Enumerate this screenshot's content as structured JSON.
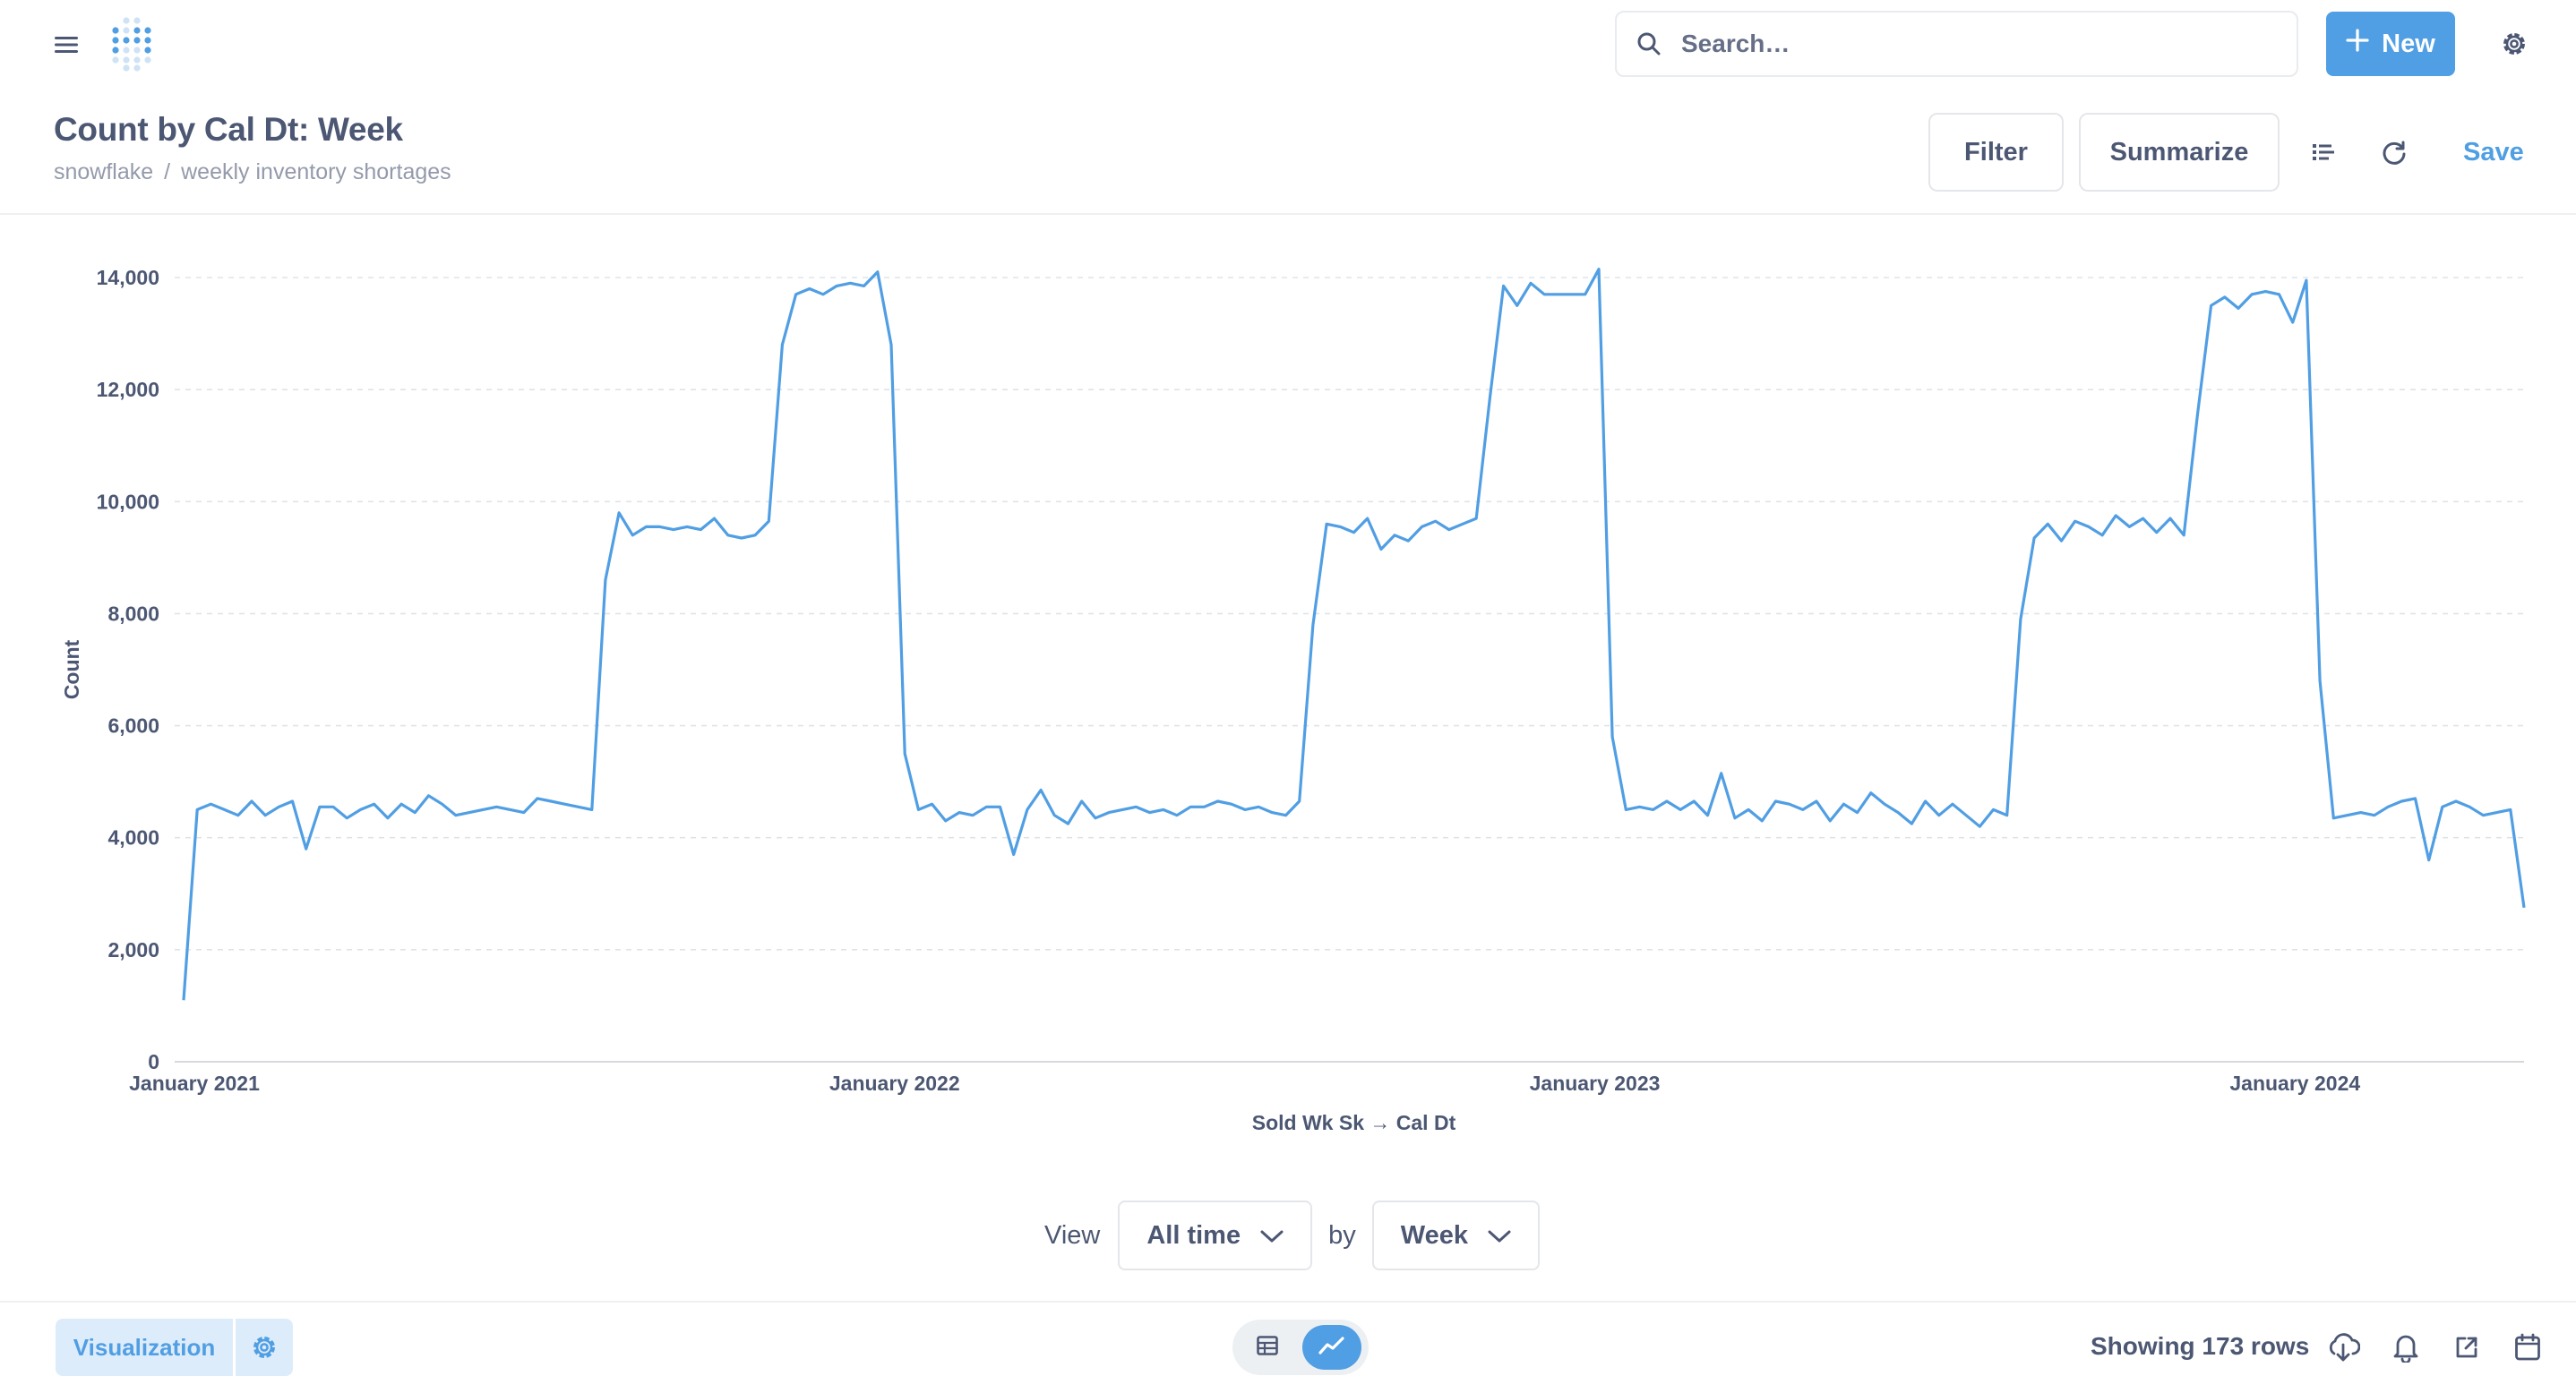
{
  "nav": {
    "search_placeholder": "Search…",
    "new_label": "New"
  },
  "header": {
    "title": "Count by Cal Dt: Week",
    "breadcrumb": [
      "snowflake",
      "/",
      "weekly inventory shortages"
    ],
    "filter_label": "Filter",
    "summarize_label": "Summarize",
    "save_label": "Save"
  },
  "view": {
    "view_label": "View",
    "range_value": "All time",
    "by_label": "by",
    "unit_value": "Week"
  },
  "footer": {
    "visualization_label": "Visualization",
    "rows_text": "Showing 173 rows"
  },
  "colors": {
    "accent": "#509ee3",
    "text": "#4c5773",
    "muted": "#949aab"
  },
  "icons": [
    "menu-icon",
    "metabase-logo",
    "search-icon",
    "plus-icon",
    "gear-icon",
    "list-icon",
    "refresh-icon",
    "chevron-down-icon",
    "table-icon",
    "line-chart-icon",
    "download-icon",
    "bell-icon",
    "share-icon",
    "calendar-icon"
  ],
  "chart_data": {
    "type": "line",
    "xlabel": "Sold Wk Sk → Cal Dt",
    "ylabel": "Count",
    "ylim": [
      0,
      14000
    ],
    "yticks": [
      0,
      2000,
      4000,
      6000,
      8000,
      10000,
      12000,
      14000
    ],
    "ytick_labels": [
      "0",
      "2,000",
      "4,000",
      "6,000",
      "8,000",
      "10,000",
      "12,000",
      "14,000"
    ],
    "xticks": [
      "January 2021",
      "January 2022",
      "January 2023",
      "January 2024"
    ],
    "x_start": "2021-01-01",
    "x_end": "2024-05-05",
    "grid": true,
    "series": [
      {
        "color": "#509ee3",
        "values": [
          1100,
          4500,
          4600,
          4500,
          4400,
          4650,
          4400,
          4550,
          4650,
          3800,
          4550,
          4550,
          4350,
          4500,
          4600,
          4350,
          4600,
          4450,
          4750,
          4600,
          4400,
          4450,
          4500,
          4550,
          4500,
          4450,
          4700,
          4650,
          4600,
          4550,
          4500,
          8600,
          9800,
          9400,
          9550,
          9550,
          9500,
          9550,
          9500,
          9700,
          9400,
          9350,
          9400,
          9650,
          12800,
          13700,
          13800,
          13700,
          13850,
          13900,
          13850,
          14100,
          12800,
          5500,
          4500,
          4600,
          4300,
          4450,
          4400,
          4550,
          4550,
          3700,
          4500,
          4850,
          4400,
          4250,
          4650,
          4350,
          4450,
          4500,
          4550,
          4450,
          4500,
          4400,
          4550,
          4550,
          4650,
          4600,
          4500,
          4550,
          4450,
          4400,
          4650,
          7800,
          9600,
          9550,
          9450,
          9700,
          9150,
          9400,
          9300,
          9550,
          9650,
          9500,
          9600,
          9700,
          11850,
          13850,
          13500,
          13900,
          13700,
          13700,
          13700,
          13700,
          14150,
          5800,
          4500,
          4550,
          4500,
          4650,
          4500,
          4650,
          4400,
          5150,
          4350,
          4500,
          4300,
          4650,
          4600,
          4500,
          4650,
          4300,
          4600,
          4450,
          4800,
          4600,
          4450,
          4250,
          4650,
          4400,
          4600,
          4400,
          4200,
          4500,
          4400,
          7900,
          9350,
          9600,
          9300,
          9650,
          9550,
          9400,
          9750,
          9550,
          9700,
          9450,
          9700,
          9400,
          11550,
          13500,
          13650,
          13450,
          13700,
          13750,
          13700,
          13200,
          13950,
          6800,
          4350,
          4400,
          4450,
          4400,
          4550,
          4650,
          4700,
          3600,
          4550,
          4650,
          4550,
          4400,
          4450,
          4500,
          2750
        ]
      }
    ]
  }
}
